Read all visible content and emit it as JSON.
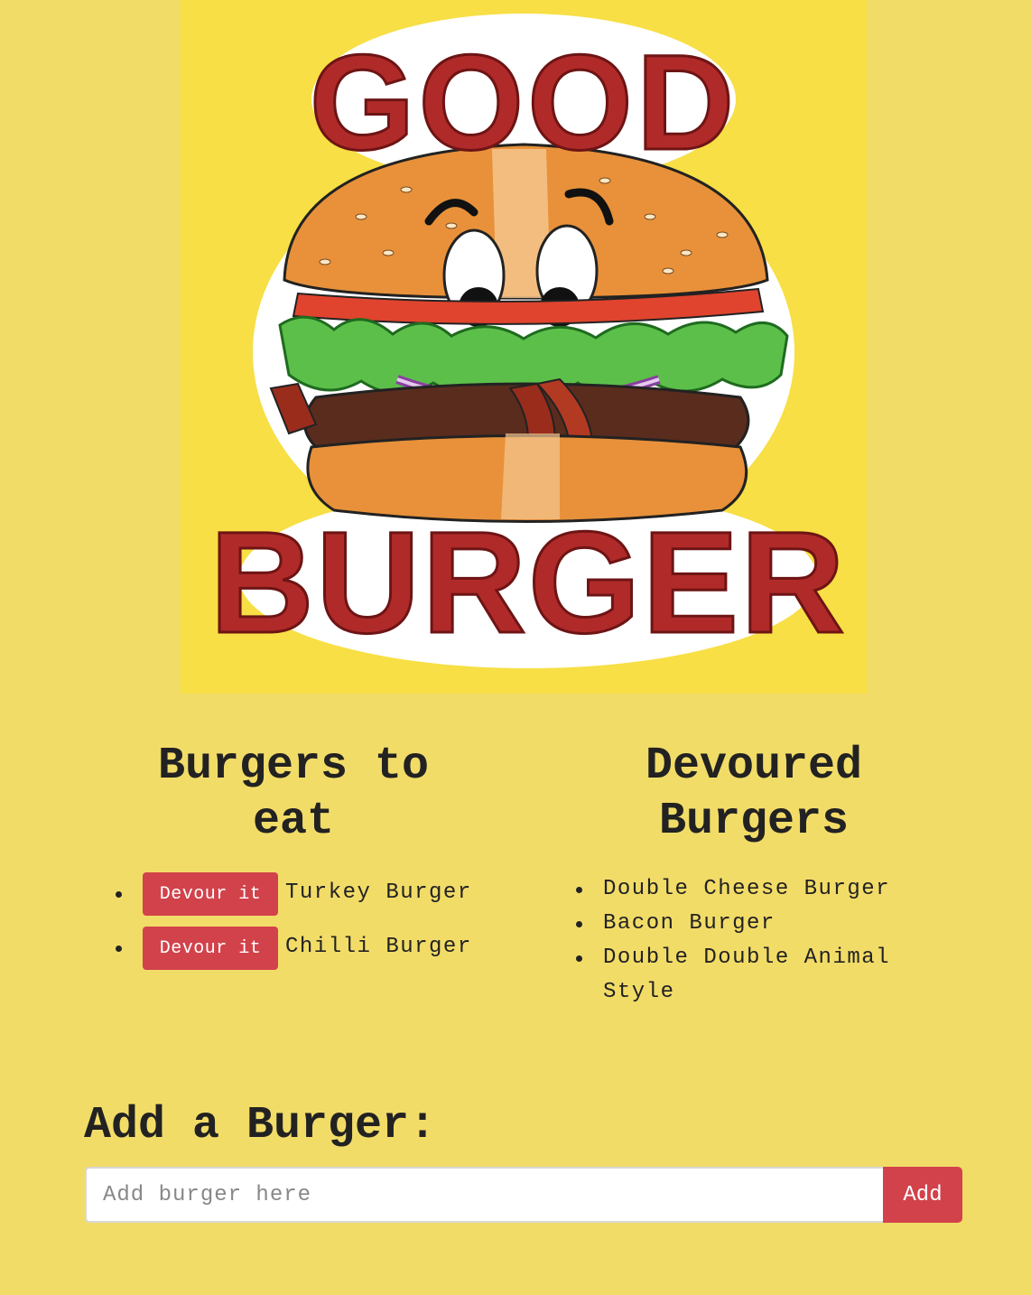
{
  "logo": {
    "top_word": "GOOD",
    "bottom_word": "BURGER",
    "colors": {
      "background": "#f7df45",
      "letters": "#b02a2a",
      "bun": "#e8913a",
      "lettuce": "#5cbf4a",
      "patty": "#5a2c1e",
      "tomato": "#e0442e"
    }
  },
  "uneaten": {
    "title": "Burgers to eat",
    "items": [
      {
        "button_label": "Devour it",
        "name": "Turkey Burger"
      },
      {
        "button_label": "Devour it",
        "name": "Chilli Burger"
      }
    ]
  },
  "devoured": {
    "title": "Devoured Burgers",
    "items": [
      "Double Cheese Burger",
      "Bacon Burger",
      "Double Double Animal Style"
    ]
  },
  "add_form": {
    "title": "Add a Burger:",
    "placeholder": "Add burger here",
    "value": "",
    "button_label": "Add"
  },
  "colors": {
    "page_background": "#f2dc68",
    "accent": "#d2424b"
  }
}
